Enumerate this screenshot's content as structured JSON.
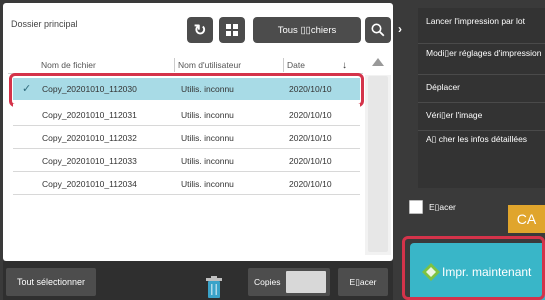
{
  "header": {
    "breadcrumb": "Dossier principal",
    "filter_label": "Tous ▯▯chiers"
  },
  "columns": {
    "filename": "Nom de fichier",
    "user": "Nom d'utilisateur",
    "date": "Date"
  },
  "rows": [
    {
      "filename": "Copy_20201010_112030",
      "user": "Utilis. inconnu",
      "date": "2020/10/10",
      "selected": true
    },
    {
      "filename": "Copy_20201010_112031",
      "user": "Utilis. inconnu",
      "date": "2020/10/10",
      "selected": false
    },
    {
      "filename": "Copy_20201010_112032",
      "user": "Utilis. inconnu",
      "date": "2020/10/10",
      "selected": false
    },
    {
      "filename": "Copy_20201010_112033",
      "user": "Utilis. inconnu",
      "date": "2020/10/10",
      "selected": false
    },
    {
      "filename": "Copy_20201010_112034",
      "user": "Utilis. inconnu",
      "date": "2020/10/10",
      "selected": false
    }
  ],
  "bottom_bar": {
    "select_all": "Tout sélectionner",
    "copies_label": "Copies",
    "copies_value": "",
    "clear": "E▯acer"
  },
  "right_menu": [
    "Lancer l'impression par lot",
    "Modi▯er réglages d'impression",
    "Déplacer",
    "Véri▯er l'image",
    "A▯ cher les infos détaillées"
  ],
  "side": {
    "checkbox_label": "E▯acer",
    "ca_label": "CA",
    "start_label": "Impr. maintenant"
  },
  "colors": {
    "selected_row": "#a8dbe6",
    "highlight_outline": "#d4334a",
    "start_button": "#39b6c8",
    "ca_button": "#e0a52c"
  }
}
